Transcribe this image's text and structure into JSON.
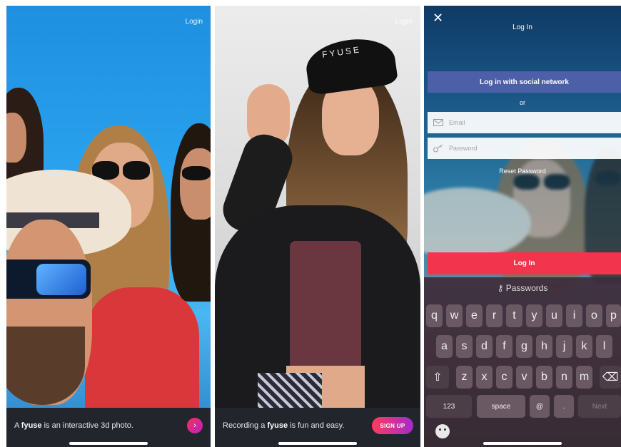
{
  "screen1": {
    "login_label": "Login",
    "caption_pre": "A ",
    "caption_bold": "fyuse",
    "caption_post": " is an interactive 3d photo.",
    "next_glyph": "›"
  },
  "screen2": {
    "login_label": "Login",
    "caption_pre": "Recording a ",
    "caption_bold": "fyuse",
    "caption_post": " is fun and easy.",
    "signup_label": "SIGN UP",
    "cap_text": "FYUSE"
  },
  "screen3": {
    "close_glyph": "✕",
    "title": "Log In",
    "social_label": "Log in with social network",
    "or_label": "or",
    "email_placeholder": "Email",
    "password_placeholder": "Password",
    "reset_label": "Reset Password",
    "login_label": "Log In",
    "keyboard": {
      "suggestion": "Passwords",
      "row1": [
        "q",
        "w",
        "e",
        "r",
        "t",
        "y",
        "u",
        "i",
        "o",
        "p"
      ],
      "row2": [
        "a",
        "s",
        "d",
        "f",
        "g",
        "h",
        "j",
        "k",
        "l"
      ],
      "row3": [
        "z",
        "x",
        "c",
        "v",
        "b",
        "n",
        "m"
      ],
      "shift_glyph": "⇧",
      "delete_glyph": "⌫",
      "numbers_label": "123",
      "space_label": "space",
      "at_label": "@",
      "dot_label": ".",
      "next_label": "Next"
    }
  }
}
